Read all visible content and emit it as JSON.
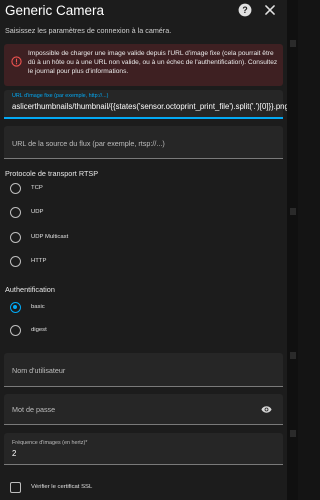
{
  "dialog": {
    "title": "Generic Camera",
    "subtitle": "Saisissez les paramètres de connexion à la caméra.",
    "help_icon": "help-circle-icon",
    "close_icon": "close-icon"
  },
  "alert": {
    "icon": "alert-circle-outline-icon",
    "color": "#3e2022",
    "text": "Impossible de charger une image valide depuis l'URL d'image fixe (cela pourrait être dû à un hôte ou à une URL non valide, ou à un échec de l'authentification). Consultez le journal pour plus d'informations."
  },
  "still_image": {
    "label": "URL d'image fixe (par exemple, http://...)",
    "value": "aslicerthumbnails/thumbnail/{{states('sensor.octoprint_print_file').split('.')[0]}}.png"
  },
  "stream_source": {
    "placeholder": "URL de la source du flux (par exemple, rtsp://...)"
  },
  "rtsp": {
    "heading": "Protocole de transport RTSP",
    "options": [
      "TCP",
      "UDP",
      "UDP Multicast",
      "HTTP"
    ]
  },
  "auth": {
    "heading": "Authentification",
    "options": [
      "basic",
      "digest"
    ],
    "selected": "basic"
  },
  "username": {
    "placeholder": "Nom d'utilisateur"
  },
  "password": {
    "placeholder": "Mot de passe",
    "icon": "eye-icon"
  },
  "frame_rate": {
    "label": "Fréquence d'images (en hertz)*",
    "value": "2"
  },
  "verify_ssl": {
    "label": "Vérifier le certificat SSL",
    "checked": false
  },
  "colors": {
    "accent": "#03a9f4",
    "surface": "#1c1c1c",
    "field": "#262626",
    "error_bg": "#3e2022",
    "error_icon": "#ef5350"
  }
}
